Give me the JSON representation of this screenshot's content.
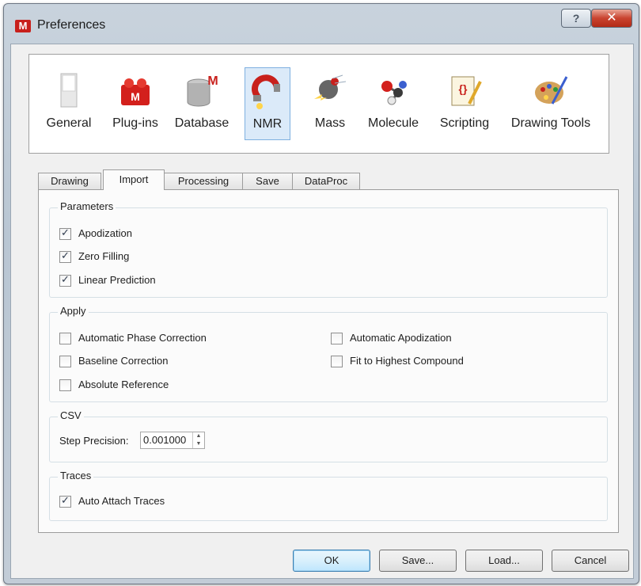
{
  "window": {
    "title": "Preferences",
    "help_glyph": "?",
    "close_glyph": "✕",
    "app_icon_letter": "M"
  },
  "categories": [
    {
      "label": "General",
      "icon": "general-icon"
    },
    {
      "label": "Plug-ins",
      "icon": "plugins-icon"
    },
    {
      "label": "Database",
      "icon": "database-icon"
    },
    {
      "label": "NMR",
      "icon": "nmr-magnet-icon",
      "selected": true
    },
    {
      "label": "Mass",
      "icon": "mass-icon"
    },
    {
      "label": "Molecule",
      "icon": "molecule-icon"
    },
    {
      "label": "Scripting",
      "icon": "scripting-icon"
    },
    {
      "label": "Drawing Tools",
      "icon": "drawing-tools-icon"
    }
  ],
  "tabs": [
    {
      "label": "Drawing"
    },
    {
      "label": "Import",
      "active": true
    },
    {
      "label": "Processing"
    },
    {
      "label": "Save"
    },
    {
      "label": "DataProc"
    }
  ],
  "parameters": {
    "title": "Parameters",
    "items": [
      {
        "label": "Apodization",
        "checked": true
      },
      {
        "label": "Zero Filling",
        "checked": true
      },
      {
        "label": "Linear Prediction",
        "checked": true
      }
    ]
  },
  "apply": {
    "title": "Apply",
    "left": [
      {
        "label": "Automatic Phase Correction",
        "checked": false
      },
      {
        "label": "Baseline Correction",
        "checked": false
      },
      {
        "label": "Absolute Reference",
        "checked": false
      }
    ],
    "right": [
      {
        "label": "Automatic Apodization",
        "checked": false
      },
      {
        "label": "Fit to Highest Compound",
        "checked": false
      }
    ]
  },
  "csv": {
    "title": "CSV",
    "step_label": "Step Precision:",
    "step_value": "0.001000"
  },
  "traces": {
    "title": "Traces",
    "items": [
      {
        "label": "Auto Attach Traces",
        "checked": true
      }
    ]
  },
  "buttons": {
    "ok": "OK",
    "save": "Save...",
    "load": "Load...",
    "cancel": "Cancel"
  },
  "colors": {
    "selected_bg": "#dbeaf9",
    "selected_border": "#7fb0e0",
    "close_red": "#c9432f",
    "title_bar": "#c2ccd7"
  }
}
